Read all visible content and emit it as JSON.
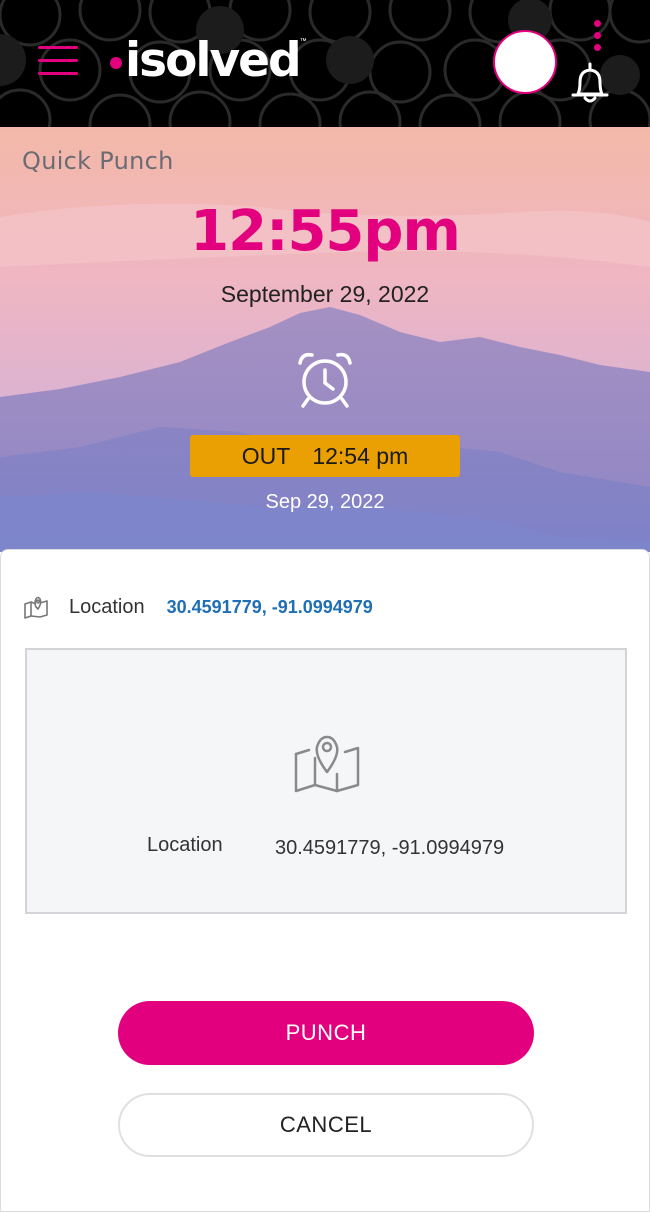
{
  "app": {
    "brand": "isolved",
    "brand_accent": "#e3007e"
  },
  "header": {
    "menu_icon": "hamburger-menu-icon",
    "more_icon": "kebab-menu-icon",
    "notifications_icon": "bell-icon"
  },
  "hero": {
    "title": "Quick Punch",
    "current_time": "12:55pm",
    "current_date": "September 29, 2022",
    "clock_icon": "alarm-clock-icon",
    "last_punch": {
      "type": "OUT",
      "time": "12:54 pm",
      "date": "Sep 29, 2022",
      "badge_color": "#eaa003"
    }
  },
  "location": {
    "label": "Location",
    "coords": "30.4591779, -91.0994979",
    "icon": "map-pin-icon",
    "panel": {
      "label": "Location",
      "coords": "30.4591779, -91.0994979"
    }
  },
  "actions": {
    "punch_label": "PUNCH",
    "cancel_label": "CANCEL"
  }
}
